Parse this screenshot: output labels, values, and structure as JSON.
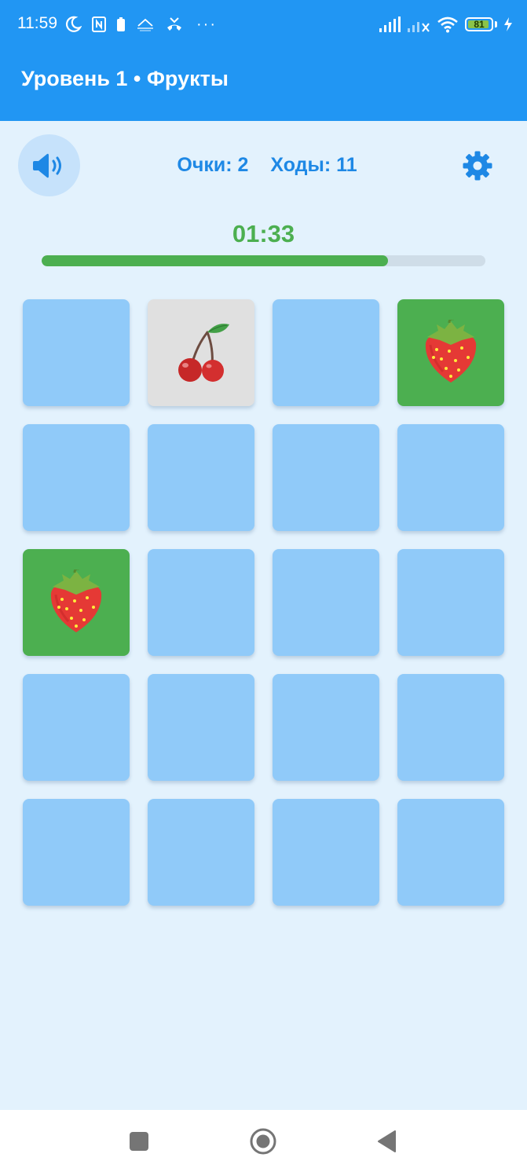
{
  "status_bar": {
    "time": "11:59",
    "more_indicator": "···",
    "battery_level": "81",
    "left_icons": [
      "moon-icon",
      "nfc-icon",
      "battery-saver-icon",
      "comfort-icon",
      "missed-call-icon"
    ],
    "right_icons": [
      "signal-icon",
      "signal-no-service-icon",
      "wifi-icon",
      "battery-icon",
      "charging-icon"
    ]
  },
  "app_bar": {
    "title": "Уровень 1 • Фрукты"
  },
  "stats": {
    "score_label": "Очки: 2",
    "moves_label": "Ходы: 11"
  },
  "controls": {
    "sound_icon": "volume-icon",
    "settings_icon": "gear-icon"
  },
  "timer": {
    "time_left": "01:33",
    "progress": 0.78
  },
  "board": {
    "columns": 4,
    "rows": 5,
    "cards": [
      {
        "state": "hidden"
      },
      {
        "state": "open",
        "fruit": "cherry"
      },
      {
        "state": "hidden"
      },
      {
        "state": "matched",
        "fruit": "strawberry"
      },
      {
        "state": "hidden"
      },
      {
        "state": "hidden"
      },
      {
        "state": "hidden"
      },
      {
        "state": "hidden"
      },
      {
        "state": "matched",
        "fruit": "strawberry"
      },
      {
        "state": "hidden"
      },
      {
        "state": "hidden"
      },
      {
        "state": "hidden"
      },
      {
        "state": "hidden"
      },
      {
        "state": "hidden"
      },
      {
        "state": "hidden"
      },
      {
        "state": "hidden"
      },
      {
        "state": "hidden"
      },
      {
        "state": "hidden"
      },
      {
        "state": "hidden"
      },
      {
        "state": "hidden"
      }
    ]
  },
  "colors": {
    "primary": "#2196f3",
    "background": "#e3f2fd",
    "card_hidden": "#90caf9",
    "card_open": "#e0e0e0",
    "card_matched": "#4caf50",
    "timer": "#4caf50",
    "stats_text": "#1e88e5"
  },
  "nav_bar": {
    "buttons": [
      "recents-square-icon",
      "home-circle-icon",
      "back-triangle-icon"
    ]
  }
}
